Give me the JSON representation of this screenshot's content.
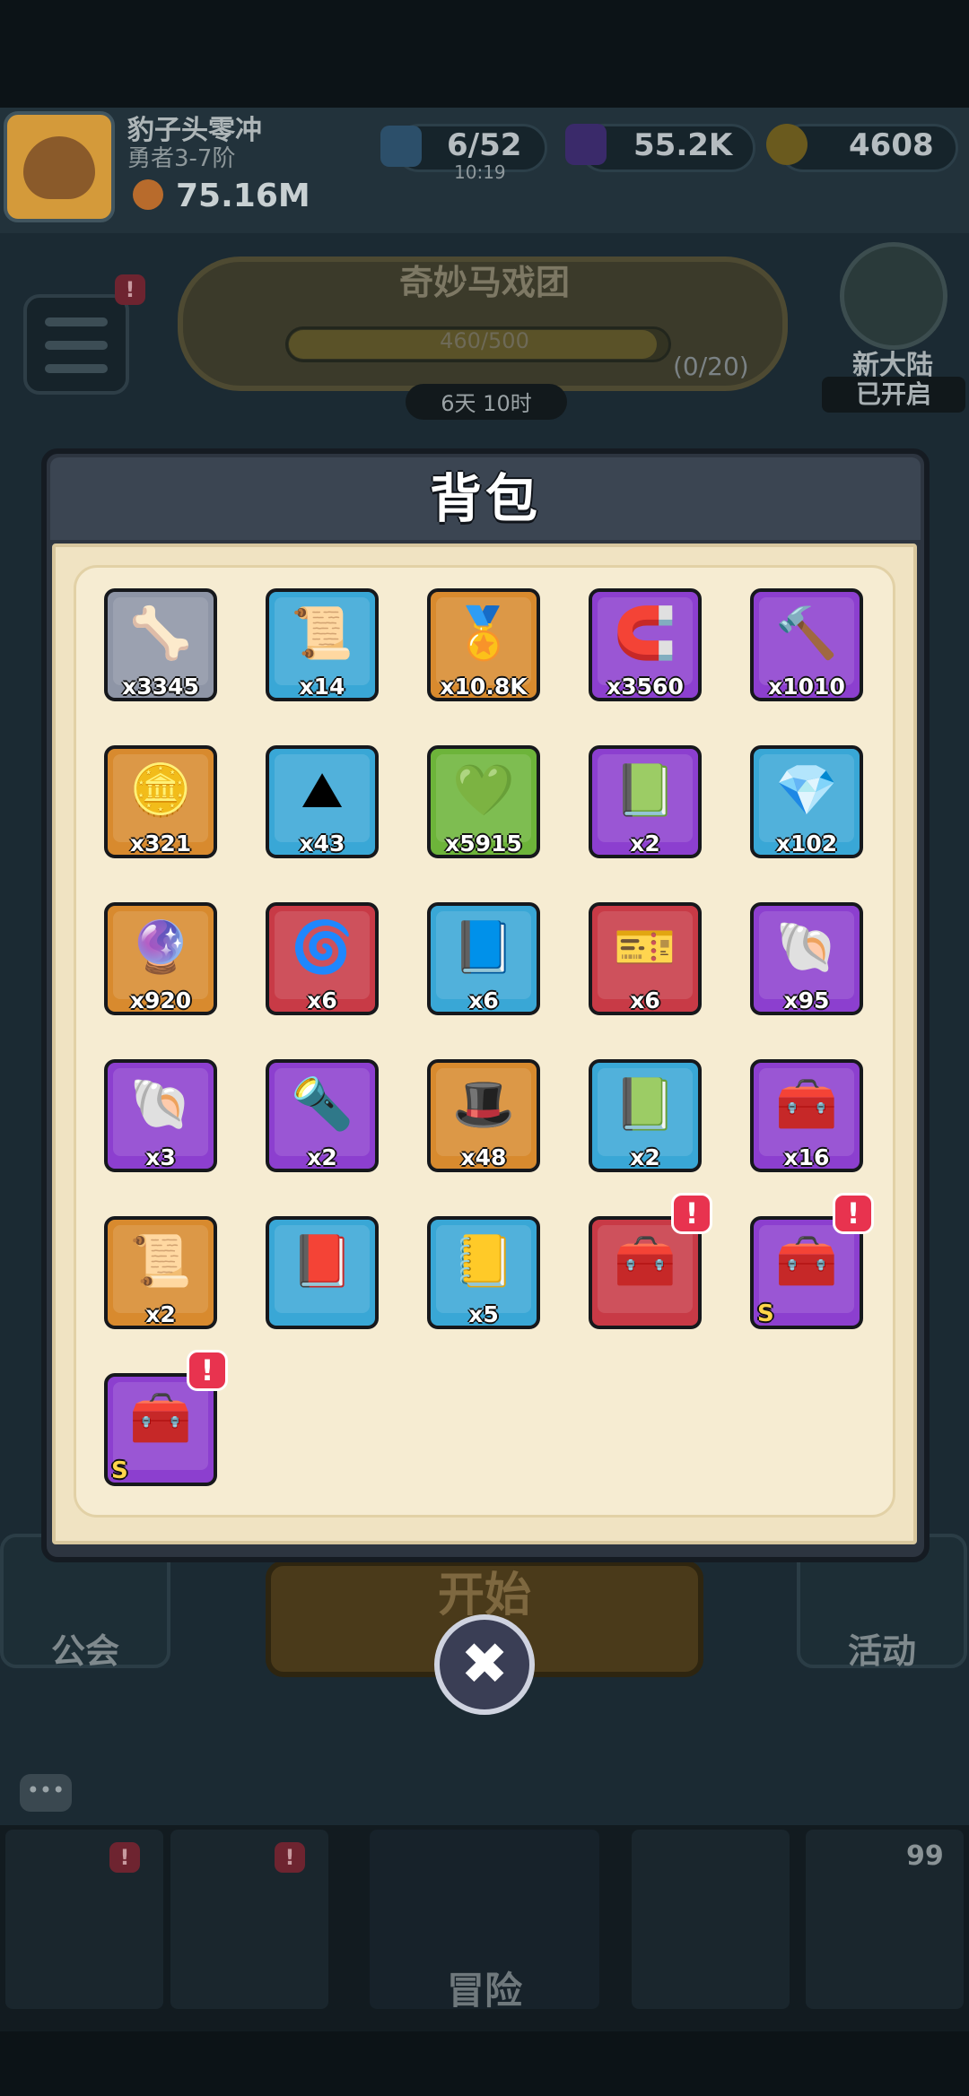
{
  "player": {
    "name": "豹子头零冲",
    "rank": "勇者3-7阶",
    "power": "75.16M"
  },
  "resources": {
    "energy": "6/52",
    "energy_timer": "10:19",
    "gems": "55.2K",
    "gold": "4608"
  },
  "event": {
    "title": "奇妙马戏团",
    "progress": "460/500",
    "count": "(0/20)",
    "timer": "6天 10时"
  },
  "world": {
    "label": "新大陆",
    "status": "已开启"
  },
  "background": {
    "guild_label": "公会",
    "activity_label": "活动",
    "start_label": "开始",
    "nav_label": "冒险",
    "nav_badge": "99"
  },
  "modal": {
    "title": "背包",
    "close_label": "✖"
  },
  "items": [
    {
      "name": "bone",
      "icon": "🦴",
      "qty": "x3345",
      "color": "#8e95a6"
    },
    {
      "name": "anvil-scroll",
      "icon": "📜",
      "qty": "x14",
      "color": "#39a7d6"
    },
    {
      "name": "gold-badge",
      "icon": "🏅",
      "qty": "x10.8K",
      "color": "#d88a2e"
    },
    {
      "name": "horseshoe",
      "icon": "🧲",
      "qty": "x3560",
      "color": "#8c3fcf"
    },
    {
      "name": "hammer",
      "icon": "🔨",
      "qty": "x1010",
      "color": "#8c3fcf"
    },
    {
      "name": "silver-coin",
      "icon": "🪙",
      "qty": "x321",
      "color": "#d88a2e"
    },
    {
      "name": "gold-sand",
      "icon": "⛰",
      "qty": "x43",
      "color": "#39a7d6"
    },
    {
      "name": "green-rune",
      "icon": "💚",
      "qty": "x5915",
      "color": "#6db43a"
    },
    {
      "name": "green-book",
      "icon": "📗",
      "qty": "x2",
      "color": "#8c3fcf"
    },
    {
      "name": "crystal-shard",
      "icon": "💎",
      "qty": "x102",
      "color": "#39a7d6"
    },
    {
      "name": "purple-gem",
      "icon": "🔮",
      "qty": "x920",
      "color": "#d88a2e"
    },
    {
      "name": "blue-orb",
      "icon": "🌀",
      "qty": "x6",
      "color": "#c83a46"
    },
    {
      "name": "skull-book",
      "icon": "📘",
      "qty": "x6",
      "color": "#39a7d6"
    },
    {
      "name": "blue-ticket",
      "icon": "🎫",
      "qty": "x6",
      "color": "#c83a46"
    },
    {
      "name": "conch-shell",
      "icon": "🐚",
      "qty": "x95",
      "color": "#8c3fcf"
    },
    {
      "name": "gold-shell",
      "icon": "🐚",
      "qty": "x3",
      "color": "#8c3fcf"
    },
    {
      "name": "flashlight",
      "icon": "🔦",
      "qty": "x2",
      "color": "#8c3fcf"
    },
    {
      "name": "witch-hat",
      "icon": "🎩",
      "qty": "x48",
      "color": "#d88a2e"
    },
    {
      "name": "leaf-book",
      "icon": "📗",
      "qty": "x2",
      "color": "#39a7d6"
    },
    {
      "name": "knight-chest",
      "icon": "🧰",
      "qty": "x16",
      "color": "#8c3fcf"
    },
    {
      "name": "parchment-scroll",
      "icon": "📜",
      "qty": "x2",
      "color": "#d88a2e"
    },
    {
      "name": "eye-book",
      "icon": "📕",
      "qty": "",
      "color": "#39a7d6"
    },
    {
      "name": "gold-book",
      "icon": "📒",
      "qty": "x5",
      "color": "#39a7d6"
    },
    {
      "name": "horseshoe-chest",
      "icon": "🧰",
      "qty": "",
      "color": "#c83a46",
      "alert": "!"
    },
    {
      "name": "s-knight-chest",
      "icon": "🧰",
      "qty": "",
      "color": "#8c3fcf",
      "alert": "!",
      "grade": "S"
    },
    {
      "name": "s-helmet-chest",
      "icon": "🧰",
      "qty": "",
      "color": "#8c3fcf",
      "alert": "!",
      "grade": "S"
    }
  ]
}
